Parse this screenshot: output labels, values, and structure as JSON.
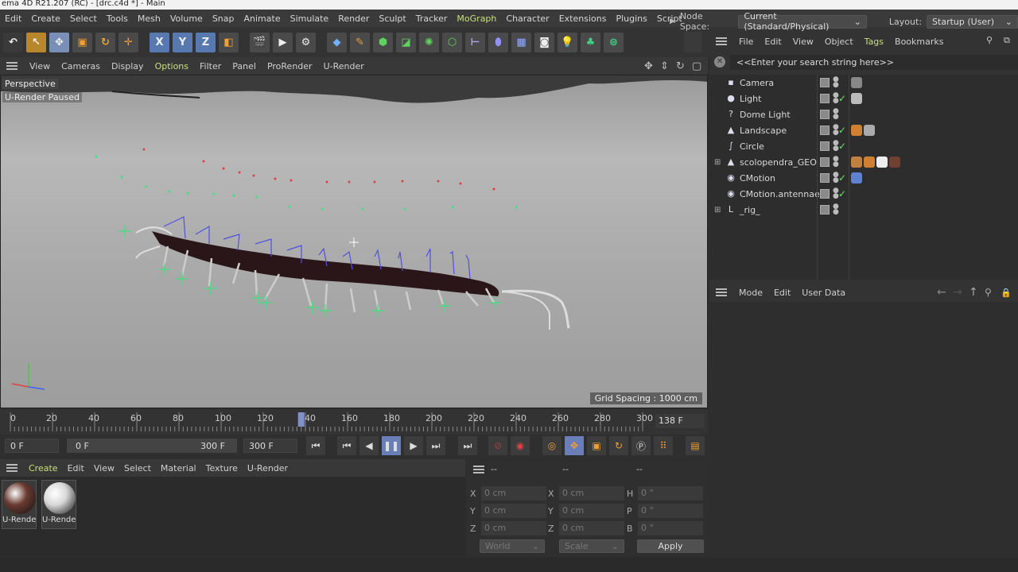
{
  "window_title": "ema 4D R21.207 (RC) - [drc.c4d *] - Main",
  "main_menu": [
    {
      "label": "Edit",
      "hl": false
    },
    {
      "label": "Create",
      "hl": false
    },
    {
      "label": "Select",
      "hl": false
    },
    {
      "label": "Tools",
      "hl": false
    },
    {
      "label": "Mesh",
      "hl": false
    },
    {
      "label": "Volume",
      "hl": false
    },
    {
      "label": "Snap",
      "hl": false
    },
    {
      "label": "Animate",
      "hl": false
    },
    {
      "label": "Simulate",
      "hl": false
    },
    {
      "label": "Render",
      "hl": false
    },
    {
      "label": "Sculpt",
      "hl": false
    },
    {
      "label": "Tracker",
      "hl": false
    },
    {
      "label": "MoGraph",
      "hl": true
    },
    {
      "label": "Character",
      "hl": false
    },
    {
      "label": "Extensions",
      "hl": false
    },
    {
      "label": "Plugins",
      "hl": false
    },
    {
      "label": "Script",
      "hl": false
    }
  ],
  "node_space": {
    "label": "Node Space:",
    "value": "Current (Standard/Physical)"
  },
  "layout": {
    "label": "Layout:",
    "value": "Startup (User)"
  },
  "toolbar": {
    "x": "X",
    "y": "Y",
    "z": "Z"
  },
  "viewport_menu": [
    {
      "label": "View",
      "hl": false
    },
    {
      "label": "Cameras",
      "hl": false
    },
    {
      "label": "Display",
      "hl": false
    },
    {
      "label": "Options",
      "hl": true
    },
    {
      "label": "Filter",
      "hl": false
    },
    {
      "label": "Panel",
      "hl": false
    },
    {
      "label": "ProRender",
      "hl": false
    },
    {
      "label": "U-Render",
      "hl": false
    }
  ],
  "viewport": {
    "mode": "Perspective",
    "status": "U-Render Paused",
    "grid_spacing": "Grid Spacing : 1000 cm"
  },
  "timeline": {
    "ticks": [
      "0",
      "20",
      "40",
      "60",
      "80",
      "100",
      "120",
      "140",
      "160",
      "180",
      "200",
      "220",
      "240",
      "260",
      "280",
      "300"
    ],
    "current_frame": "138 F",
    "playhead_fraction": 0.46
  },
  "transport": {
    "start": "0 F",
    "range_start": "0 F",
    "range_end": "300 F",
    "end": "300 F"
  },
  "material_menu": [
    {
      "label": "Create",
      "hl": true
    },
    {
      "label": "Edit",
      "hl": false
    },
    {
      "label": "View",
      "hl": false
    },
    {
      "label": "Select",
      "hl": false
    },
    {
      "label": "Material",
      "hl": false
    },
    {
      "label": "Texture",
      "hl": false
    },
    {
      "label": "U-Render",
      "hl": false
    }
  ],
  "materials": [
    {
      "label": "U-Rende",
      "color": "#6a3a30"
    },
    {
      "label": "U-Rende",
      "color": "#d8d8d8"
    }
  ],
  "coords": {
    "headers": [
      "--",
      "--",
      "--"
    ],
    "rows": [
      {
        "a": "X",
        "av": "0 cm",
        "b": "X",
        "bv": "0 cm",
        "c": "H",
        "cv": "0 °"
      },
      {
        "a": "Y",
        "av": "0 cm",
        "b": "Y",
        "bv": "0 cm",
        "c": "P",
        "cv": "0 °"
      },
      {
        "a": "Z",
        "av": "0 cm",
        "b": "Z",
        "bv": "0 cm",
        "c": "B",
        "cv": "0 °"
      }
    ],
    "world": "World",
    "scale": "Scale",
    "apply": "Apply"
  },
  "object_menu": [
    {
      "label": "File",
      "hl": false
    },
    {
      "label": "Edit",
      "hl": false
    },
    {
      "label": "View",
      "hl": false
    },
    {
      "label": "Object",
      "hl": false
    },
    {
      "label": "Tags",
      "hl": true
    },
    {
      "label": "Bookmarks",
      "hl": false
    }
  ],
  "search_placeholder": "<<Enter your search string here>>",
  "objects": [
    {
      "name": "Camera",
      "icon": "camera-icon",
      "glyph": "▪",
      "check": false,
      "tags": [
        "#888"
      ]
    },
    {
      "name": "Light",
      "icon": "light-icon",
      "glyph": "●",
      "check": true,
      "tags": [
        "#bbb"
      ]
    },
    {
      "name": "Dome Light",
      "icon": "dome-light-icon",
      "glyph": "?",
      "check": false,
      "tags": []
    },
    {
      "name": "Landscape",
      "icon": "landscape-icon",
      "glyph": "▲",
      "check": true,
      "tags": [
        "#d08030",
        "#aaaaaa"
      ]
    },
    {
      "name": "Circle",
      "icon": "circle-spline-icon",
      "glyph": "∫",
      "check": true,
      "tags": []
    },
    {
      "name": "scolopendra_GEO",
      "icon": "polygon-object-icon",
      "glyph": "▲",
      "check": false,
      "tags": [
        "#c08040",
        "#d08030",
        "#eeeeee",
        "#704030"
      ]
    },
    {
      "name": "CMotion",
      "icon": "cmotion-icon",
      "glyph": "◉",
      "check": true,
      "tags": [
        "#6080d0"
      ]
    },
    {
      "name": "CMotion.antennae",
      "icon": "cmotion-icon",
      "glyph": "◉",
      "check": true,
      "tags": []
    },
    {
      "name": "_rig_",
      "icon": "null-object-icon",
      "glyph": "L",
      "check": false,
      "tags": []
    }
  ],
  "attr_menu": [
    {
      "label": "Mode"
    },
    {
      "label": "Edit"
    },
    {
      "label": "User Data"
    }
  ]
}
